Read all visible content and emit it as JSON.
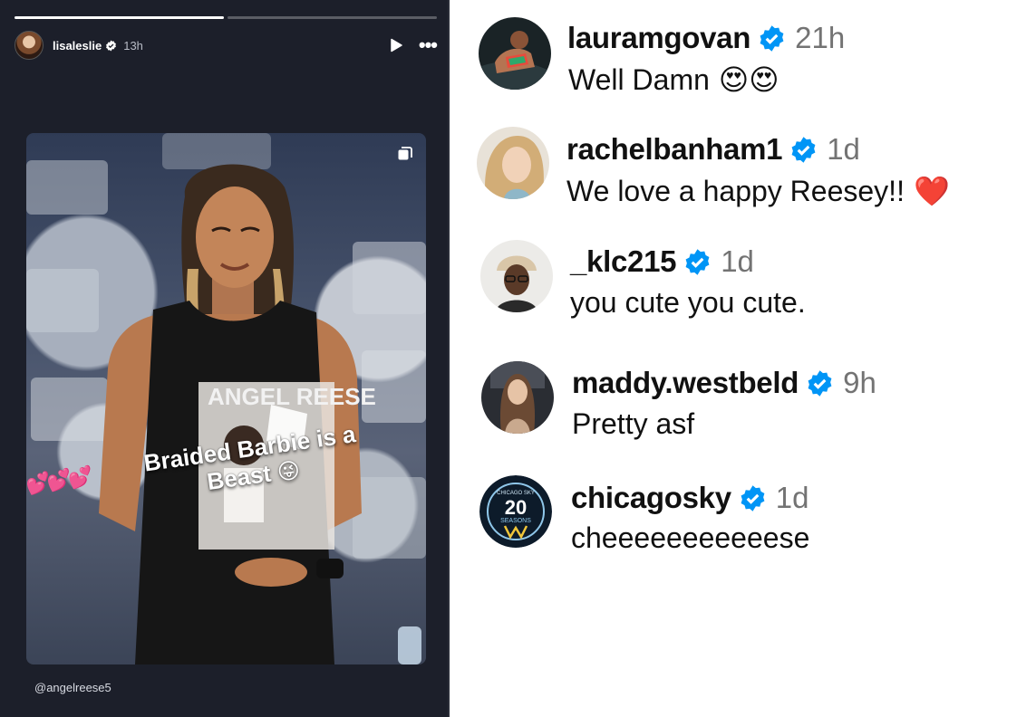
{
  "story": {
    "username": "lisaleslie",
    "time": "13h",
    "progress": [
      1.0,
      0.0
    ],
    "mention": "@angelreese5",
    "sticker": {
      "hearts": "💕💕💕",
      "text": "Braided Barbie is a Beast",
      "emoji": "😜"
    },
    "shirt_text": "ANGEL REESE",
    "icons": {
      "verified": "verified-badge-icon",
      "play": "play-icon",
      "more": "more-options-icon",
      "copy": "multi-image-icon"
    }
  },
  "comments": [
    {
      "username": "lauramgovan",
      "time": "21h",
      "text": "Well Damn",
      "emoji": "😍😍",
      "avatar_color": "#3a2a24"
    },
    {
      "username": "rachelbanham1",
      "time": "1d",
      "text": "We love a happy Reesey!!",
      "emoji": "❤️",
      "avatar_color": "#c9a57a"
    },
    {
      "username": "_klc215",
      "time": "1d",
      "text": "you cute you cute.",
      "emoji": "",
      "avatar_color": "#d8cfc2"
    },
    {
      "username": "maddy.westbeld",
      "time": "9h",
      "text": "Pretty asf",
      "emoji": "",
      "avatar_color": "#5b4a3e"
    },
    {
      "username": "chicagosky",
      "time": "1d",
      "text": "cheeeeeeeeeeese",
      "emoji": "",
      "avatar_color": "#0d1b2a"
    }
  ],
  "chicagosky_logo": {
    "top": "CHICAGO SKY",
    "number": "20",
    "label": "SEASONS"
  },
  "colors": {
    "verified": "#0095f6",
    "story_bg": "#1c1f2a",
    "time_gray": "#737373"
  }
}
